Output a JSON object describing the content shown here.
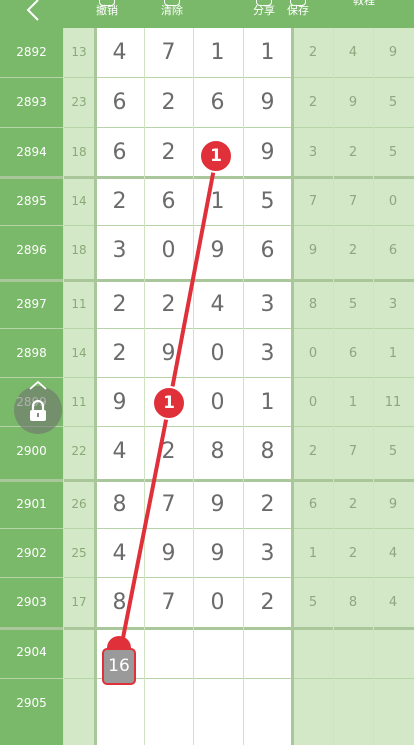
{
  "toolbar": {
    "undo_label": "撤销",
    "clear_label": "清除",
    "share_label": "分享",
    "save_label": "保存",
    "tutorial_label": "教程"
  },
  "rows": [
    {
      "period": "2892",
      "sum": "13",
      "digits": [
        "4",
        "7",
        "1",
        "1"
      ],
      "stats": [
        "2",
        "4",
        "9"
      ]
    },
    {
      "period": "2893",
      "sum": "23",
      "digits": [
        "6",
        "2",
        "6",
        "9"
      ],
      "stats": [
        "2",
        "9",
        "5"
      ]
    },
    {
      "period": "2894",
      "sum": "18",
      "digits": [
        "6",
        "2",
        "",
        "9"
      ],
      "stats": [
        "3",
        "2",
        "5"
      ]
    },
    {
      "period": "2895",
      "sum": "14",
      "digits": [
        "2",
        "6",
        "1",
        "5"
      ],
      "stats": [
        "7",
        "7",
        "0"
      ]
    },
    {
      "period": "2896",
      "sum": "18",
      "digits": [
        "3",
        "0",
        "9",
        "6"
      ],
      "stats": [
        "9",
        "2",
        "6"
      ]
    },
    {
      "period": "2897",
      "sum": "11",
      "digits": [
        "2",
        "2",
        "4",
        "3"
      ],
      "stats": [
        "8",
        "5",
        "3"
      ]
    },
    {
      "period": "2898",
      "sum": "14",
      "digits": [
        "2",
        "9",
        "0",
        "3"
      ],
      "stats": [
        "0",
        "6",
        "1"
      ]
    },
    {
      "period": "2899",
      "sum": "11",
      "digits": [
        "9",
        "",
        "0",
        "1"
      ],
      "stats": [
        "0",
        "1",
        "11"
      ]
    },
    {
      "period": "2900",
      "sum": "22",
      "digits": [
        "4",
        "2",
        "8",
        "8"
      ],
      "stats": [
        "2",
        "7",
        "5"
      ]
    },
    {
      "period": "2901",
      "sum": "26",
      "digits": [
        "8",
        "7",
        "9",
        "2"
      ],
      "stats": [
        "6",
        "2",
        "9"
      ]
    },
    {
      "period": "2902",
      "sum": "25",
      "digits": [
        "4",
        "9",
        "9",
        "3"
      ],
      "stats": [
        "1",
        "2",
        "4"
      ]
    },
    {
      "period": "2903",
      "sum": "17",
      "digits": [
        "8",
        "7",
        "0",
        "2"
      ],
      "stats": [
        "5",
        "8",
        "4"
      ]
    },
    {
      "period": "2904",
      "sum": "",
      "digits": [
        "",
        "",
        "",
        ""
      ],
      "stats": [
        "",
        "",
        ""
      ]
    },
    {
      "period": "2905",
      "sum": "",
      "digits": [
        "",
        "",
        "",
        ""
      ],
      "stats": [
        "",
        "",
        ""
      ]
    }
  ],
  "markers": {
    "top_badge": "1",
    "mid_badge": "1",
    "pick_value": "16"
  },
  "colors": {
    "accent_green": "#7ab86a",
    "light_green": "#d3e8c6",
    "marker_red": "#e0303a"
  }
}
